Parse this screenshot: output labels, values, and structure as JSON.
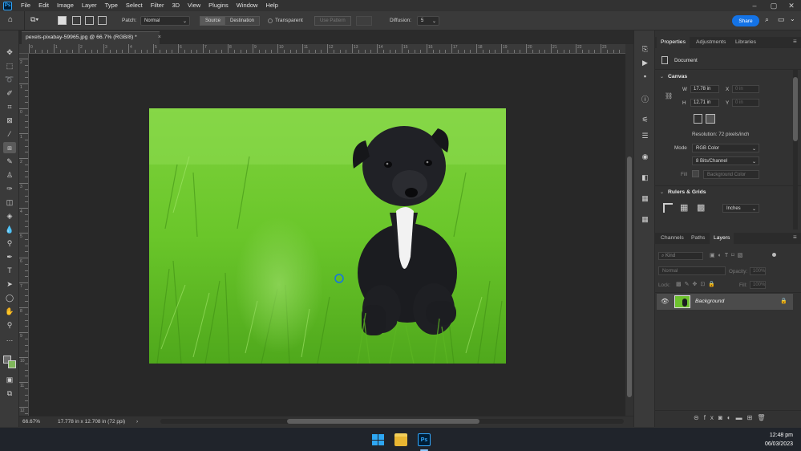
{
  "menubar": {
    "app_icon": "Ps",
    "items": [
      "File",
      "Edit",
      "Image",
      "Layer",
      "Type",
      "Select",
      "Filter",
      "3D",
      "View",
      "Plugins",
      "Window",
      "Help"
    ]
  },
  "options": {
    "patch_label": "Patch:",
    "patch_mode": "Normal",
    "source_label": "Source",
    "destination_label": "Destination",
    "transparent_label": "Transparent",
    "use_pattern_label": "Use Pattern",
    "diffusion_label": "Diffusion:",
    "diffusion_value": "5",
    "share_label": "Share"
  },
  "document": {
    "tab_title": "pexels-pixabay-59965.jpg @ 66.7% (RGB/8) *",
    "tab_close": "×"
  },
  "rulers": {
    "h": [
      "0",
      "1",
      "2",
      "3",
      "4",
      "5",
      "6",
      "7",
      "8",
      "9",
      "10",
      "11",
      "12",
      "13",
      "14",
      "15",
      "16",
      "17",
      "18",
      "19",
      "20",
      "21",
      "22",
      "23",
      "24"
    ],
    "v": [
      "2",
      "1",
      "0",
      "1",
      "2",
      "3",
      "4",
      "5",
      "6",
      "7",
      "8",
      "9",
      "10",
      "11",
      "12",
      "13",
      "14"
    ]
  },
  "status": {
    "zoom": "66.67%",
    "doc_info": "17.778 in x 12.708 in (72 ppi)",
    "arrow": "›"
  },
  "properties": {
    "tabs": [
      "Properties",
      "Adjustments",
      "Libraries"
    ],
    "doc_label": "Document",
    "canvas_title": "Canvas",
    "w_label": "W",
    "w_value": "17.78 in",
    "h_label": "H",
    "h_value": "12.71 in",
    "x_label": "X",
    "x_value": "0 in",
    "y_label": "Y",
    "y_value": "0 in",
    "resolution": "Resolution: 72 pixels/inch",
    "mode_label": "Mode",
    "mode_value": "RGB Color",
    "depth_value": "8 Bits/Channel",
    "fill_label": "Fill",
    "fill_value": "Background Color",
    "rulers_title": "Rulers & Grids",
    "units_value": "Inches"
  },
  "layers": {
    "tabs": [
      "Channels",
      "Paths",
      "Layers"
    ],
    "kind_placeholder": "Kind",
    "blend_mode": "Normal",
    "opacity_label": "Opacity:",
    "opacity_value": "100%",
    "lock_label": "Lock:",
    "fill_label": "Fill:",
    "fill_value": "100%",
    "layer_name": "Background"
  },
  "taskbar": {
    "time": "12:48 pm",
    "date": "06/03/2023"
  },
  "colors": {
    "accent": "#1473e6",
    "foreground_swatch": "#6c6c6c",
    "background_swatch": "#7fb65a"
  }
}
